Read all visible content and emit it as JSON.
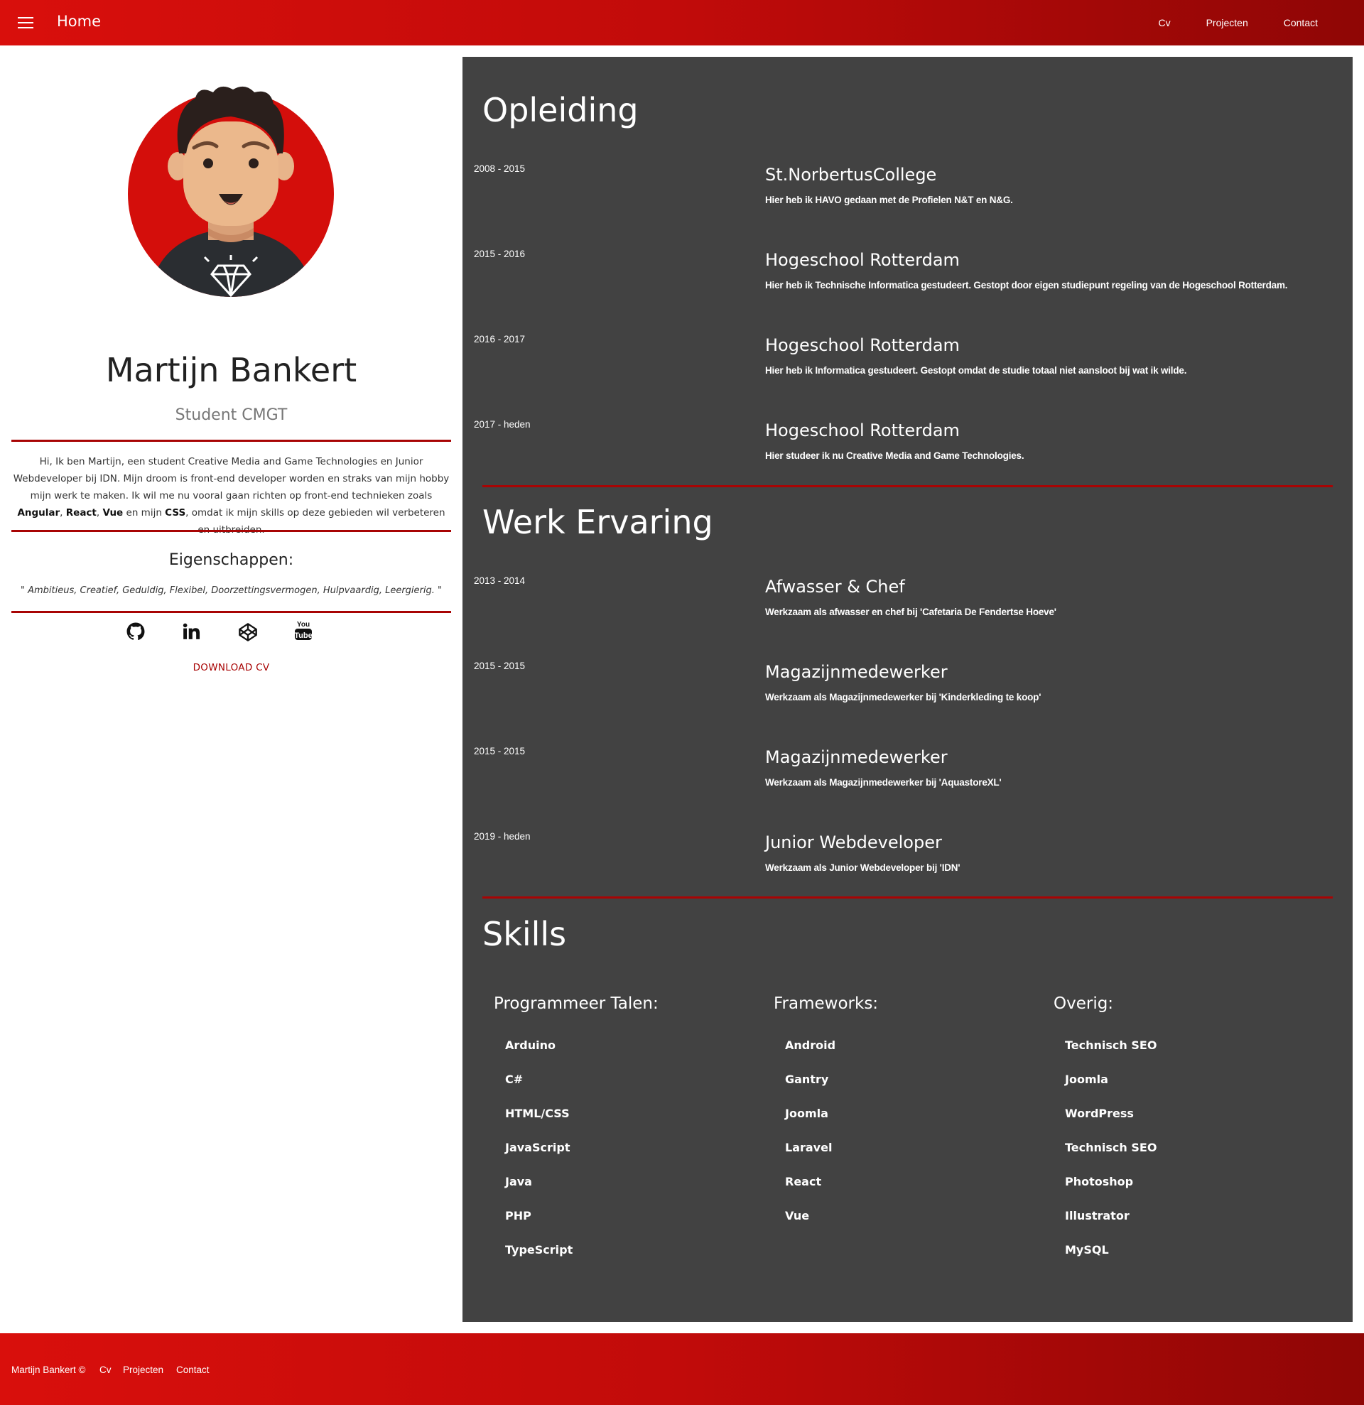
{
  "header": {
    "menu_icon": "hamburger-menu-icon",
    "brand": "Home",
    "nav": [
      "Cv",
      "Projecten",
      "Contact"
    ]
  },
  "profile": {
    "avatar": "avatar-illustration",
    "name": "Martijn Bankert",
    "role": "Student CMGT",
    "bio": {
      "text1": "Hi, Ik ben Martijn, een student Creative Media and Game Technologies en Junior Webdeveloper bij IDN. Mijn droom is front-end developer worden en straks van mijn hobby mijn werk te maken. Ik wil me nu vooral gaan richten op front-end technieken zoals ",
      "angular": "Angular",
      "sep1": ", ",
      "react": "React",
      "sep2": ", ",
      "vue": "Vue",
      "text2": " en mijn ",
      "css": "CSS",
      "text3": ", omdat ik mijn skills op deze gebieden wil verbeteren en uitbreiden."
    },
    "traits_title": "Eigenschappen:",
    "traits": "\" Ambitieus, Creatief, Geduldig, Flexibel, Doorzettingsvermogen, Hulpvaardig, Leergierig. \"",
    "socials": [
      "github-icon",
      "linkedin-icon",
      "codepen-icon",
      "youtube-icon"
    ],
    "download": "DOWNLOAD CV"
  },
  "opleiding": {
    "title": "Opleiding",
    "items": [
      {
        "date": "2008 - 2015",
        "title": "St.NorbertusCollege",
        "desc": "Hier heb ik HAVO gedaan met de Profielen N&T en N&G."
      },
      {
        "date": "2015 - 2016",
        "title": "Hogeschool Rotterdam",
        "desc": "Hier heb ik Technische Informatica gestudeert. Gestopt door eigen studiepunt regeling van de Hogeschool Rotterdam."
      },
      {
        "date": "2016 - 2017",
        "title": "Hogeschool Rotterdam",
        "desc": "Hier heb ik Informatica gestudeert. Gestopt omdat de studie totaal niet aansloot bij wat ik wilde."
      },
      {
        "date": "2017 - heden",
        "title": "Hogeschool Rotterdam",
        "desc": "Hier studeer ik nu Creative Media and Game Technologies."
      }
    ]
  },
  "werk": {
    "title": "Werk Ervaring",
    "items": [
      {
        "date": "2013 - 2014",
        "title": "Afwasser & Chef",
        "desc": "Werkzaam als afwasser en chef bij 'Cafetaria De Fendertse Hoeve'"
      },
      {
        "date": "2015 - 2015",
        "title": "Magazijnmedewerker",
        "desc": "Werkzaam als Magazijnmedewerker bij 'Kinderkleding te koop'"
      },
      {
        "date": "2015 - 2015",
        "title": "Magazijnmedewerker",
        "desc": "Werkzaam als Magazijnmedewerker bij 'AquastoreXL'"
      },
      {
        "date": "2019 - heden",
        "title": "Junior Webdeveloper",
        "desc": "Werkzaam als Junior Webdeveloper bij 'IDN'"
      }
    ]
  },
  "skills": {
    "title": "Skills",
    "columns": [
      {
        "head": "Programmeer Talen:",
        "items": [
          "Arduino",
          "C#",
          "HTML/CSS",
          "JavaScript",
          "Java",
          "PHP",
          "TypeScript"
        ]
      },
      {
        "head": "Frameworks:",
        "items": [
          "Android",
          "Gantry",
          "Joomla",
          "Laravel",
          "React",
          "Vue"
        ]
      },
      {
        "head": "Overig:",
        "items": [
          "Technisch SEO",
          "Joomla",
          "WordPress",
          "Technisch SEO",
          "Photoshop",
          "Illustrator",
          "MySQL"
        ]
      }
    ]
  },
  "footer": {
    "copyright": "Martijn Bankert ©",
    "links": [
      "Cv",
      "Projecten",
      "Contact"
    ]
  },
  "colors": {
    "brand_red": "#d90f0c",
    "dark_red": "#a80404",
    "panel_bg": "#424242"
  }
}
